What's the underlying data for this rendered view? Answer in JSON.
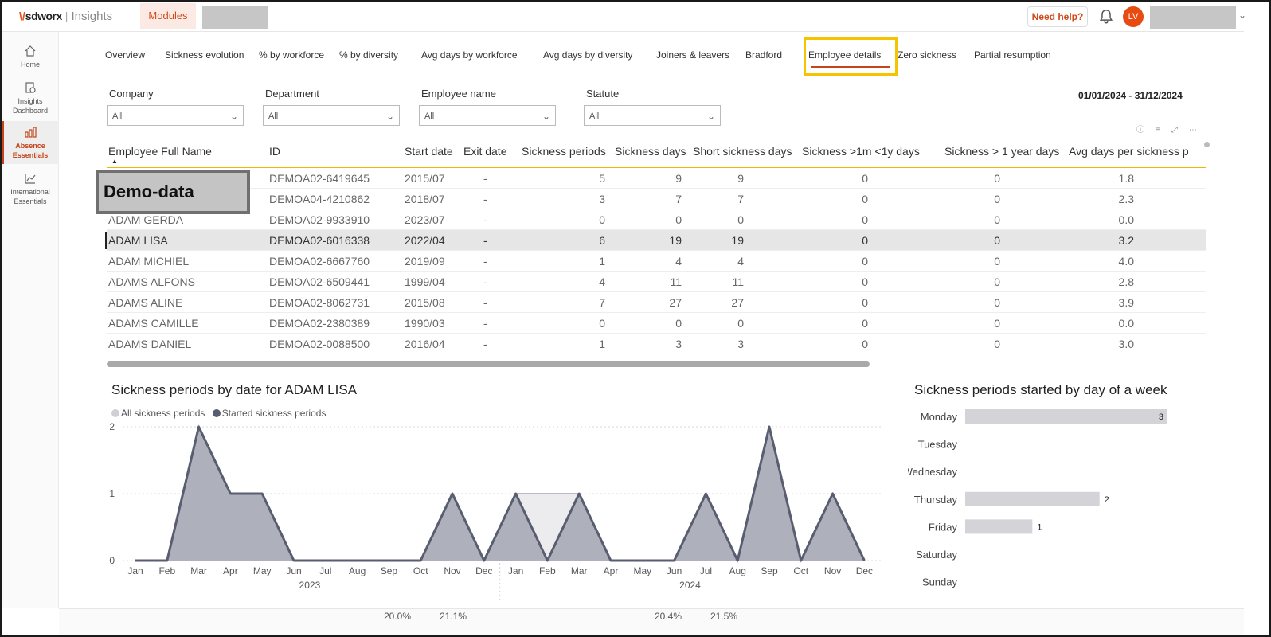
{
  "header": {
    "logo_mark": "\\/",
    "logo_brand": "sdworx",
    "logo_sep": "|",
    "logo_product": "Insights",
    "modules_label": "Modules",
    "need_help_label": "Need help?",
    "avatar_initials": "LV",
    "accent_color": "#e8501d"
  },
  "sidebar": {
    "items": [
      {
        "label": "Home",
        "icon": "home-icon"
      },
      {
        "label": "Insights Dashboard",
        "icon": "dashboard-icon"
      },
      {
        "label": "Absence Essentials",
        "icon": "bar-chart-icon",
        "active": true
      },
      {
        "label": "International Essentials",
        "icon": "chart-line-icon"
      }
    ]
  },
  "tabs": [
    "Overview",
    "Sickness evolution",
    "% by workforce",
    "% by diversity",
    "Avg days by workforce",
    "Avg days by diversity",
    "Joiners & leavers",
    "Bradford",
    "Employee details",
    "Zero sickness",
    "Partial resumption"
  ],
  "active_tab": "Employee details",
  "filters": [
    {
      "label": "Company",
      "value": "All"
    },
    {
      "label": "Department",
      "value": "All"
    },
    {
      "label": "Employee name",
      "value": "All"
    },
    {
      "label": "Statute",
      "value": "All"
    }
  ],
  "date_range": "01/01/2024 - 31/12/2024",
  "table": {
    "columns": [
      "Employee Full Name",
      "ID",
      "Start date",
      "Exit date",
      "Sickness periods",
      "Sickness days",
      "Short sickness days",
      "Sickness >1m <1y days",
      "Sickness > 1 year days",
      "Avg days per sickness p"
    ],
    "rows": [
      [
        "",
        "DEMOA02-6419645",
        "2015/07",
        "-",
        "5",
        "9",
        "9",
        "0",
        "0",
        "1.8"
      ],
      [
        "",
        "DEMOA04-4210862",
        "2018/07",
        "-",
        "3",
        "7",
        "7",
        "0",
        "0",
        "2.3"
      ],
      [
        "ADAM GERDA",
        "DEMOA02-9933910",
        "2023/07",
        "-",
        "0",
        "0",
        "0",
        "0",
        "0",
        "0.0"
      ],
      [
        "ADAM LISA",
        "DEMOA02-6016338",
        "2022/04",
        "-",
        "6",
        "19",
        "19",
        "0",
        "0",
        "3.2"
      ],
      [
        "ADAM MICHIEL",
        "DEMOA02-6667760",
        "2019/09",
        "-",
        "1",
        "4",
        "4",
        "0",
        "0",
        "4.0"
      ],
      [
        "ADAMS ALFONS",
        "DEMOA02-6509441",
        "1999/04",
        "-",
        "4",
        "11",
        "11",
        "0",
        "0",
        "2.8"
      ],
      [
        "ADAMS ALINE",
        "DEMOA02-8062731",
        "2015/08",
        "-",
        "7",
        "27",
        "27",
        "0",
        "0",
        "3.9"
      ],
      [
        "ADAMS CAMILLE",
        "DEMOA02-2380389",
        "1990/03",
        "-",
        "0",
        "0",
        "0",
        "0",
        "0",
        "0.0"
      ],
      [
        "ADAMS DANIEL",
        "DEMOA02-0088500",
        "2016/04",
        "-",
        "1",
        "3",
        "3",
        "0",
        "0",
        "3.0"
      ]
    ],
    "selected_row": 3
  },
  "demo_overlay": "Demo-data",
  "chart_data": [
    {
      "type": "area",
      "title": "Sickness periods by date for ADAM LISA",
      "legend": [
        "All sickness periods",
        "Started sickness periods"
      ],
      "legend_colors": [
        "#cfcfd4",
        "#585e6f"
      ],
      "x": [
        "Jan",
        "Feb",
        "Mar",
        "Apr",
        "May",
        "Jun",
        "Jul",
        "Aug",
        "Sep",
        "Oct",
        "Nov",
        "Dec",
        "Jan",
        "Feb",
        "Mar",
        "Apr",
        "May",
        "Jun",
        "Jul",
        "Aug",
        "Sep",
        "Oct",
        "Nov",
        "Dec"
      ],
      "x_groups": [
        {
          "label": "2023",
          "count": 12
        },
        {
          "label": "2024",
          "count": 12
        }
      ],
      "y_ticks": [
        "0",
        "1",
        "2"
      ],
      "ylim": [
        0,
        2
      ],
      "series": [
        {
          "name": "All sickness periods",
          "values": [
            0,
            0,
            2,
            1,
            1,
            0,
            0,
            0,
            0,
            0,
            1,
            0,
            1,
            1,
            1,
            0,
            0,
            0,
            1,
            0,
            2,
            0,
            1,
            0
          ]
        },
        {
          "name": "Started sickness periods",
          "values": [
            0,
            0,
            2,
            1,
            1,
            0,
            0,
            0,
            0,
            0,
            1,
            0,
            1,
            0,
            1,
            0,
            0,
            0,
            1,
            0,
            2,
            0,
            1,
            0
          ]
        }
      ]
    },
    {
      "type": "bar",
      "title": "Sickness periods started by day of a week",
      "categories": [
        "Monday",
        "Tuesday",
        "Wednesday",
        "Thursday",
        "Friday",
        "Saturday",
        "Sunday"
      ],
      "values": [
        3,
        null,
        null,
        2,
        1,
        null,
        null
      ],
      "bar_color": "#d3d3d8"
    }
  ],
  "bleed_text": [
    "20.0%",
    "21.1%",
    "20.4%",
    "21.5%"
  ]
}
